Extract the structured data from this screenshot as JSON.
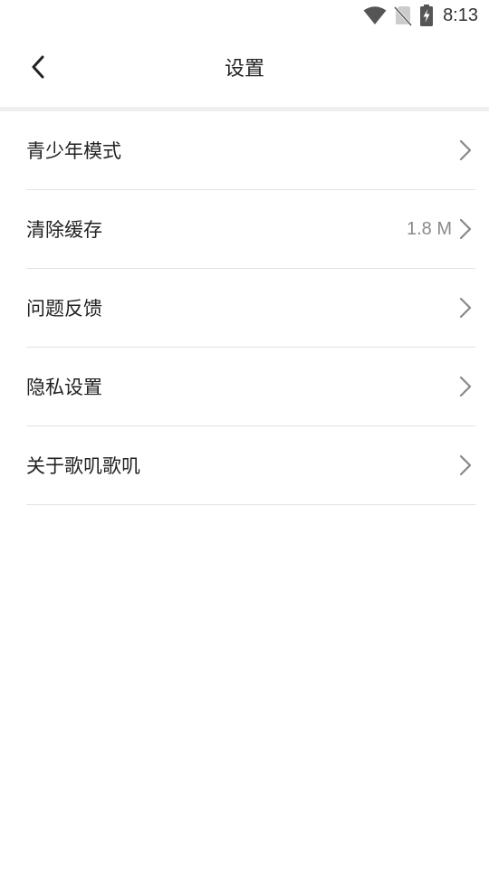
{
  "status_bar": {
    "time": "8:13",
    "icons": [
      "wifi-icon",
      "no-sim-icon",
      "battery-charging-icon"
    ]
  },
  "header": {
    "title": "设置",
    "back_icon": "chevron-left-icon"
  },
  "settings": {
    "items": [
      {
        "label": "青少年模式",
        "value": ""
      },
      {
        "label": "清除缓存",
        "value": "1.8 M"
      },
      {
        "label": "问题反馈",
        "value": ""
      },
      {
        "label": "隐私设置",
        "value": ""
      },
      {
        "label": "关于歌叽歌叽",
        "value": ""
      }
    ]
  },
  "colors": {
    "text": "#222222",
    "secondary_text": "#8a8a8a",
    "divider": "#e2e2e2",
    "section_gap": "#efefef",
    "chevron": "#888888"
  }
}
